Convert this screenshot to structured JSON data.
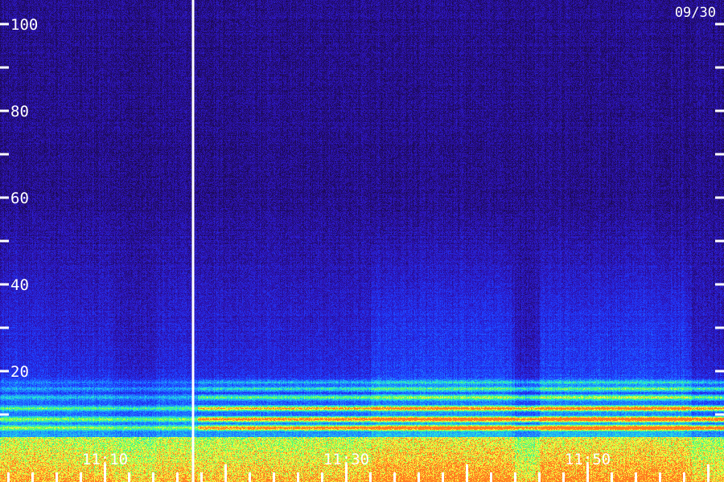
{
  "chart_data": {
    "type": "heatmap",
    "title": "",
    "date_label": "09/30",
    "xlabel": "",
    "ylabel": "",
    "y_axis": {
      "ylim": [
        0,
        100
      ],
      "tick_labels": [
        "20",
        "40",
        "60",
        "80",
        "100"
      ],
      "labeled_ticks": [
        20,
        40,
        60,
        80,
        100
      ],
      "minor_ticks": [
        10,
        30,
        50,
        70,
        90
      ]
    },
    "x_axis": {
      "tick_labels": [
        "11:10",
        "11:30",
        "11:50"
      ],
      "label_times_min": [
        670,
        690,
        710
      ],
      "xlim_min": [
        661.3,
        721.3
      ],
      "tick_times_min": [
        662,
        664,
        666,
        668,
        670,
        672,
        674,
        676,
        678,
        680,
        682,
        684,
        686,
        688,
        690,
        692,
        694,
        696,
        698,
        700,
        702,
        704,
        706,
        708,
        710,
        712,
        714,
        716,
        718,
        720
      ]
    },
    "marker_time_min": 677.3,
    "background_color": "#1a0d50",
    "colormap": [
      "#1c0a52",
      "#2d14b8",
      "#1e3cff",
      "#1e8cff",
      "#20e0e0",
      "#60ff60",
      "#ffff40",
      "#ff7a20"
    ],
    "bands": [
      {
        "freq": 7,
        "intensity": 0.9
      },
      {
        "freq": 9,
        "intensity": 0.95
      },
      {
        "freq": 11.5,
        "intensity": 0.85
      },
      {
        "freq": 14,
        "intensity": 0.55
      },
      {
        "freq": 16,
        "intensity": 0.45
      },
      {
        "freq": 17.5,
        "intensity": 0.35
      }
    ]
  }
}
